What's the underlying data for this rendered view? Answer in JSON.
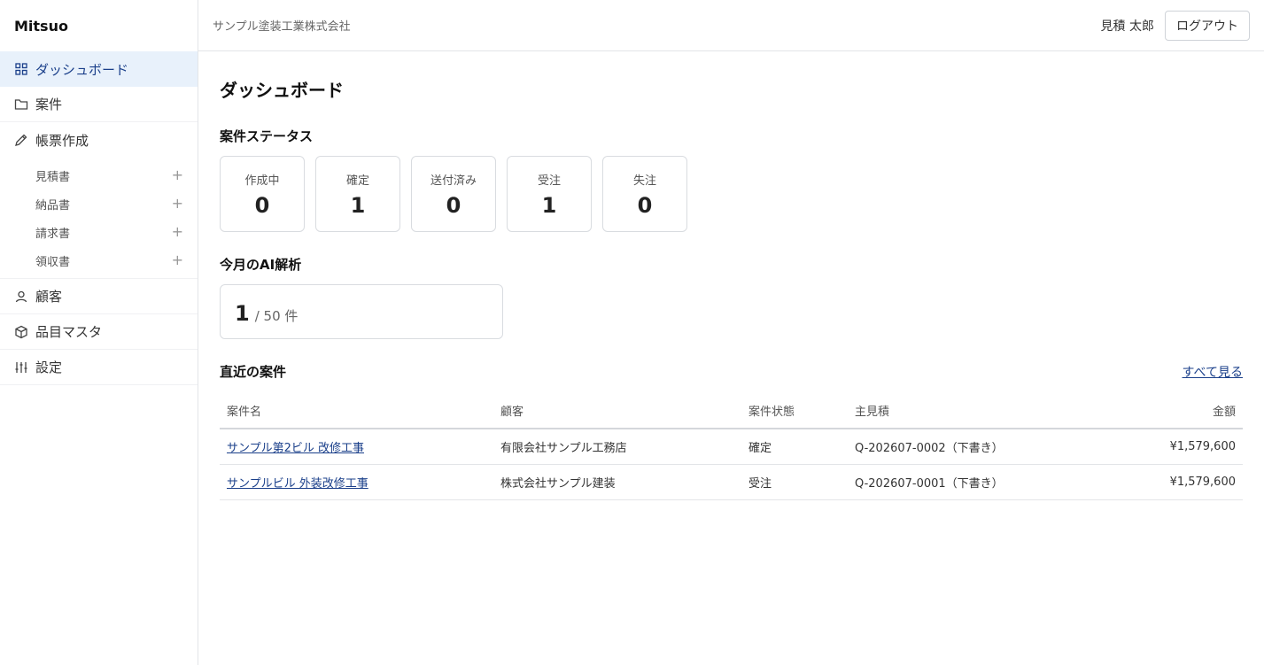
{
  "app": {
    "brand": "Mitsuo"
  },
  "header": {
    "company": "サンプル塗装工業株式会社",
    "user": "見積 太郎",
    "logout_label": "ログアウト"
  },
  "sidebar": {
    "items": [
      {
        "label": "ダッシュボード",
        "icon": "grid-icon"
      },
      {
        "label": "案件",
        "icon": "folder-icon"
      },
      {
        "label": "帳票作成",
        "icon": "pencil-icon"
      },
      {
        "label": "顧客",
        "icon": "user-icon"
      },
      {
        "label": "品目マスタ",
        "icon": "cube-icon"
      },
      {
        "label": "設定",
        "icon": "sliders-icon"
      }
    ],
    "documents": [
      {
        "label": "見積書",
        "add": "+"
      },
      {
        "label": "納品書",
        "add": "+"
      },
      {
        "label": "請求書",
        "add": "+"
      },
      {
        "label": "領収書",
        "add": "+"
      }
    ]
  },
  "main": {
    "title": "ダッシュボード",
    "status_title": "案件ステータス",
    "statuses": [
      {
        "label": "作成中",
        "count": "0"
      },
      {
        "label": "確定",
        "count": "1"
      },
      {
        "label": "送付済み",
        "count": "0"
      },
      {
        "label": "受注",
        "count": "1"
      },
      {
        "label": "失注",
        "count": "0"
      }
    ],
    "ai_title": "今月のAI解析",
    "ai_used": "1",
    "ai_rest": "/ 50 件",
    "recent_title": "直近の案件",
    "see_all": "すべて見る",
    "table": {
      "headers": [
        "案件名",
        "顧客",
        "案件状態",
        "主見積",
        "金額"
      ],
      "rows": [
        {
          "name": "サンプル第2ビル 改修工事",
          "customer": "有限会社サンプル工務店",
          "status": "確定",
          "estimate": "Q-202607-0002（下書き）",
          "amount": "¥1,579,600"
        },
        {
          "name": "サンプルビル 外装改修工事",
          "customer": "株式会社サンプル建装",
          "status": "受注",
          "estimate": "Q-202607-0001（下書き）",
          "amount": "¥1,579,600"
        }
      ]
    }
  },
  "colors": {
    "accent": "#1a3f8a",
    "active_bg": "#e8f1fb"
  }
}
